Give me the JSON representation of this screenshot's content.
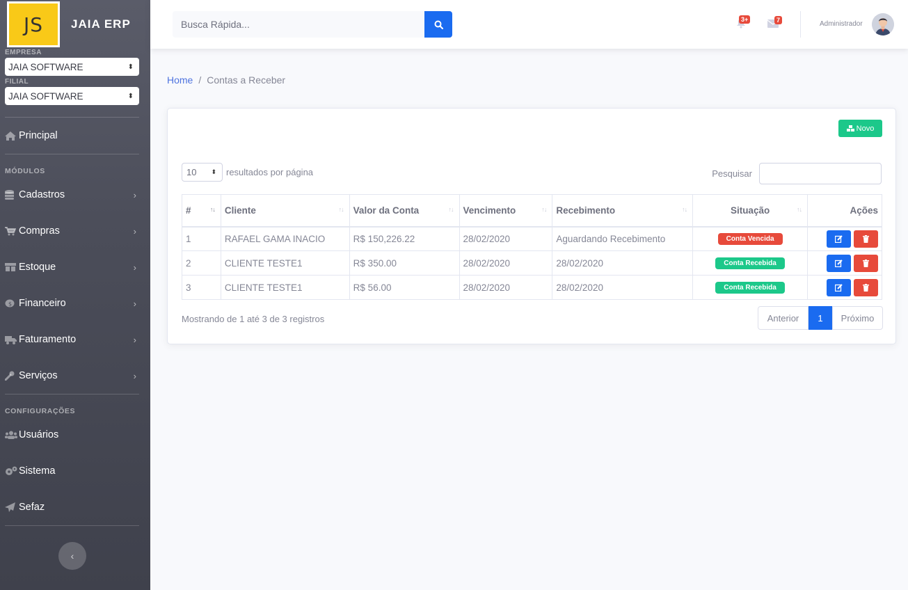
{
  "app": {
    "logo_text": "JS",
    "brand": "JAIA ERP"
  },
  "sidebar": {
    "empresa_label": "EMPRESA",
    "empresa_value": "JAIA SOFTWARE",
    "filial_label": "FILIAL",
    "filial_value": "JAIA SOFTWARE",
    "principal": "Principal",
    "modulos_heading": "MÓDULOS",
    "modules": [
      {
        "label": "Cadastros",
        "icon": "database-icon"
      },
      {
        "label": "Compras",
        "icon": "cart-icon"
      },
      {
        "label": "Estoque",
        "icon": "warehouse-icon"
      },
      {
        "label": "Financeiro",
        "icon": "coins-icon"
      },
      {
        "label": "Faturamento",
        "icon": "truck-icon"
      },
      {
        "label": "Serviços",
        "icon": "wrench-icon"
      }
    ],
    "config_heading": "CONFIGURAÇÕES",
    "config": [
      {
        "label": "Usuários",
        "icon": "users-icon"
      },
      {
        "label": "Sistema",
        "icon": "cogs-icon"
      },
      {
        "label": "Sefaz",
        "icon": "paper-plane-icon"
      }
    ]
  },
  "topbar": {
    "search_placeholder": "Busca Rápida...",
    "alerts_count": "3+",
    "messages_count": "7",
    "user_name": "Administrador"
  },
  "breadcrumb": {
    "home": "Home",
    "separator": "/",
    "current": "Contas a Receber"
  },
  "card": {
    "new_button": "Novo",
    "page_length": "10",
    "page_length_label": "resultados por página",
    "search_label": "Pesquisar",
    "columns": [
      "#",
      "Cliente",
      "Valor da Conta",
      "Vencimento",
      "Recebimento",
      "Situação",
      "Ações"
    ],
    "rows": [
      {
        "id": "1",
        "cliente": "RAFAEL GAMA INACIO",
        "valor": "R$ 150,226.22",
        "vencimento": "28/02/2020",
        "recebimento": "Aguardando Recebimento",
        "situacao": "Conta Vencida",
        "status_color": "#e74a3b"
      },
      {
        "id": "2",
        "cliente": "CLIENTE TESTE1",
        "valor": "R$ 350.00",
        "vencimento": "28/02/2020",
        "recebimento": "28/02/2020",
        "situacao": "Conta Recebida",
        "status_color": "#1cc88a"
      },
      {
        "id": "3",
        "cliente": "CLIENTE TESTE1",
        "valor": "R$ 56.00",
        "vencimento": "28/02/2020",
        "recebimento": "28/02/2020",
        "situacao": "Conta Recebida",
        "status_color": "#1cc88a"
      }
    ],
    "info": "Mostrando de 1 até 3 de 3 registros",
    "pager": {
      "prev": "Anterior",
      "current": "1",
      "next": "Próximo"
    }
  },
  "colors": {
    "primary": "#1a6bf0",
    "success": "#1cc88a",
    "danger": "#e74a3b",
    "sidebar": "#4b4d59"
  }
}
